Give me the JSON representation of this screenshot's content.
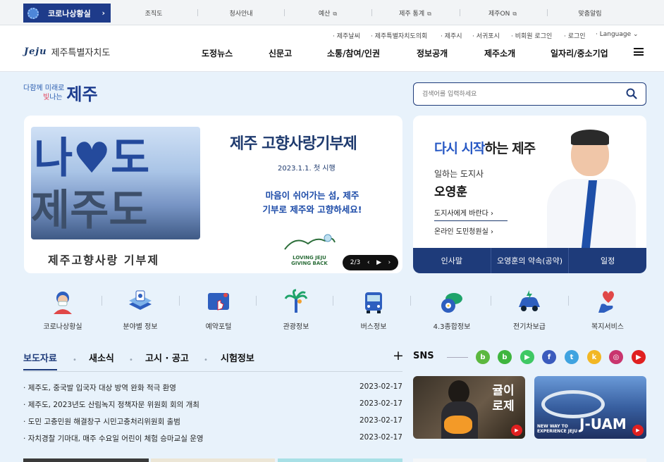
{
  "topbar": {
    "covid_label": "코로나상황실",
    "links": [
      "조직도",
      "청사안내",
      "예산",
      "제주 통계",
      "제주ON",
      "맞춤알림"
    ]
  },
  "header": {
    "utility": [
      "제주날씨",
      "제주특별자치도의회",
      "제주시",
      "서귀포시",
      "비회원 로그인",
      "로그인",
      "Language"
    ],
    "logo_mark": "Jeju",
    "logo_name": "제주특별자치도",
    "nav": [
      "도정뉴스",
      "신문고",
      "소통/참여/인권",
      "정보공개",
      "제주소개",
      "일자리/중소기업"
    ]
  },
  "slogan": {
    "line1": "다함께 미래로",
    "line2_highlight": "빛",
    "line2_rest": "나는",
    "big": "제주"
  },
  "search": {
    "placeholder": "검색어를 입력하세요"
  },
  "banner": {
    "title": "제주 고향사랑기부제",
    "date": "2023.1.1. 첫 시행",
    "copy1": "마음이 쉬어가는 섬, 제주",
    "copy2": "기부로 제주와 고향하세요!",
    "art_top": "나♥도",
    "art_bottom": "제주도",
    "subtitle": "제주고향사랑 기부제",
    "logo1": "LOVING JEJU",
    "logo2": "GIVING BACK",
    "pager": "2/3"
  },
  "governor": {
    "title_hl": "다시 시작",
    "title_rest": "하는 제주",
    "role": "일하는 도지사",
    "name": "오영훈",
    "link1": "도지사에게 바란다",
    "link2": "온라인 도민청원실",
    "tabs": [
      "인사말",
      "오영훈의 약속(공약)",
      "일정"
    ]
  },
  "quick": [
    "코로나상황실",
    "분야별 정보",
    "예약포털",
    "관광정보",
    "버스정보",
    "4.3종합정보",
    "전기차보급",
    "복지서비스"
  ],
  "news": {
    "tabs": [
      "보도자료",
      "새소식",
      "고시 · 공고",
      "시험정보"
    ],
    "items": [
      {
        "title": "제주도, 중국발 입국자 대상 방역 완화 적극 환영",
        "date": "2023-02-17"
      },
      {
        "title": "제주도, 2023년도 산림녹지 정책자문 위원회 회의 개최",
        "date": "2023-02-17"
      },
      {
        "title": "도민 고충민원 해결창구 시민고충처리위원회 출범",
        "date": "2023-02-17"
      },
      {
        "title": "자치경찰 기마대, 매주 수요일 어린이 체험 승마교실 운영",
        "date": "2023-02-17"
      }
    ]
  },
  "sns": {
    "title": "SNS",
    "icons": [
      {
        "name": "blog",
        "glyph": "b",
        "color": "#5cb83f"
      },
      {
        "name": "band",
        "glyph": "b",
        "color": "#3fb53f"
      },
      {
        "name": "tv",
        "glyph": "▶",
        "color": "#3fc864"
      },
      {
        "name": "facebook",
        "glyph": "f",
        "color": "#3b5bbd"
      },
      {
        "name": "twitter",
        "glyph": "t",
        "color": "#3fa3e0"
      },
      {
        "name": "kakao",
        "glyph": "k",
        "color": "#f2b724"
      },
      {
        "name": "instagram",
        "glyph": "◎",
        "color": "#c9356e"
      },
      {
        "name": "youtube",
        "glyph": "▶",
        "color": "#e02020"
      }
    ],
    "thumb1_text": "귤이 로제",
    "thumb2_line1": "NEW WAY TO",
    "thumb2_line2": "EXPERIENCE JEJU",
    "thumb2_big": "J-UAM"
  }
}
